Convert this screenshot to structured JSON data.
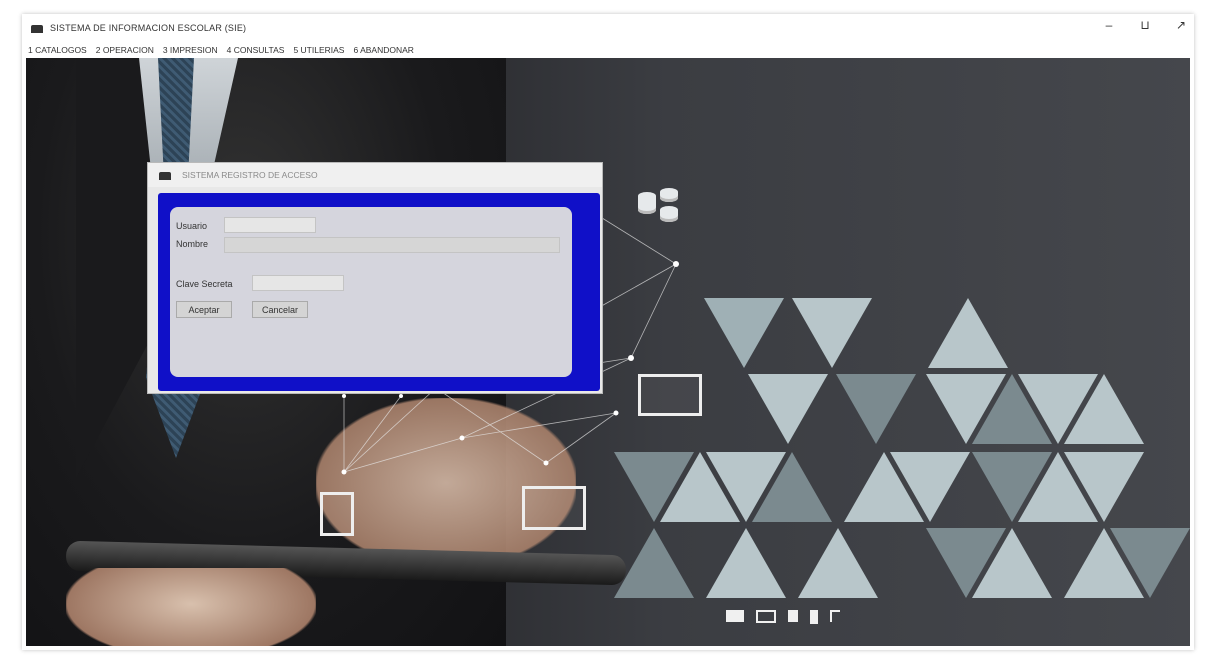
{
  "window": {
    "title": "SISTEMA DE INFORMACION ESCOLAR (SIE)",
    "controls": {
      "minimize": "–",
      "restore": "⊔",
      "close": "↗"
    }
  },
  "menu": {
    "items": [
      "1 CATALOGOS",
      "2 OPERACION",
      "3 IMPRESION",
      "4 CONSULTAS",
      "5 UTILERIAS",
      "6 ABANDONAR"
    ]
  },
  "login": {
    "title": "SISTEMA REGISTRO DE ACCESO",
    "usuario_label": "Usuario",
    "usuario_value": "",
    "nombre_label": "Nombre",
    "nombre_value": "",
    "clave_label": "Clave Secreta",
    "clave_value": "",
    "aceptar_label": "Aceptar",
    "cancelar_label": "Cancelar",
    "frame_color": "#1010c8"
  },
  "background": {
    "icons": [
      "database-icon",
      "monitor-icon",
      "chart-icon",
      "worker-icon",
      "tools-icon",
      "bar-chart-icon",
      "drill-icon",
      "excavator-icon",
      "paint-icon",
      "cloud-icon",
      "wrench-icon",
      "gear-icon",
      "camera-icon",
      "mail-icon",
      "phone-icon"
    ]
  }
}
